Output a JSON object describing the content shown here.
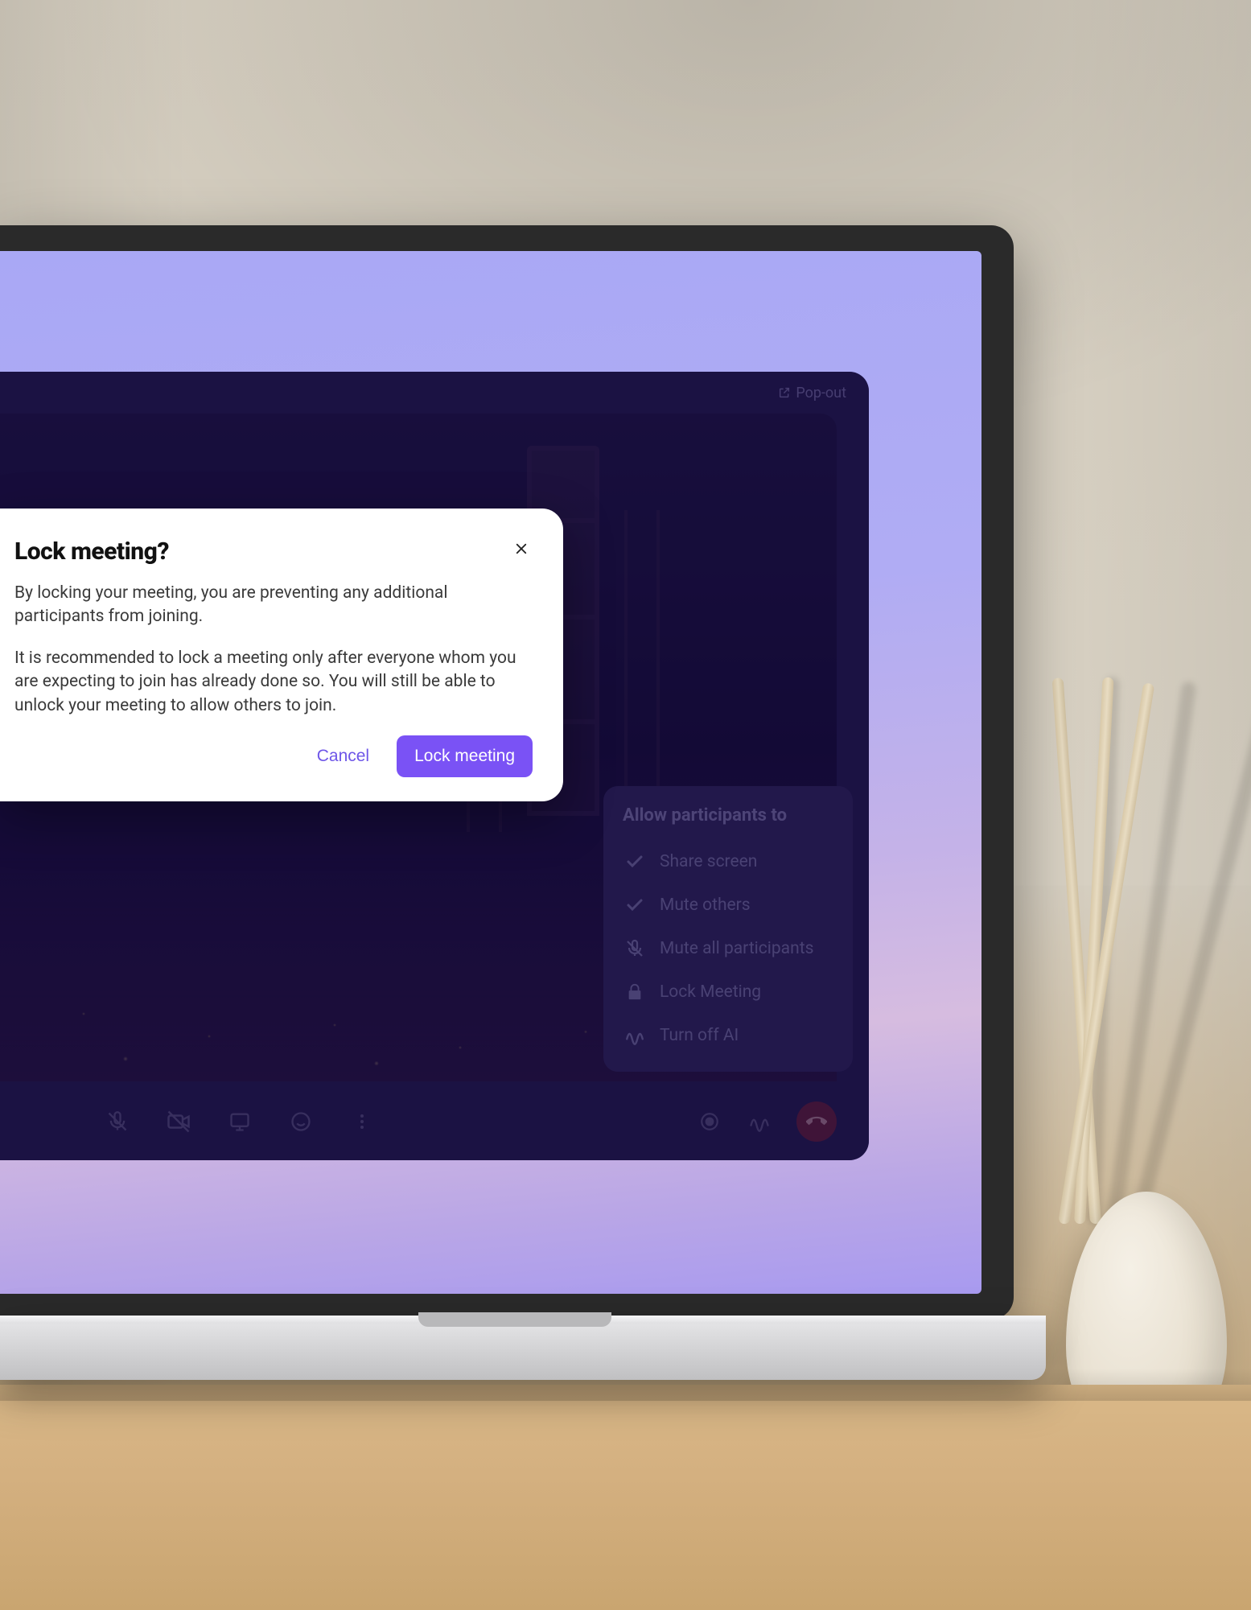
{
  "app": {
    "popout_label": "Pop-out"
  },
  "host_menu": {
    "title": "Allow participants to",
    "items": [
      {
        "icon": "check",
        "label": "Share screen"
      },
      {
        "icon": "check",
        "label": "Mute others"
      },
      {
        "icon": "mic-off",
        "label": "Mute all participants"
      },
      {
        "icon": "lock",
        "label": "Lock Meeting"
      },
      {
        "icon": "ai",
        "label": "Turn off AI"
      }
    ]
  },
  "toolbar": {
    "icons": [
      "mic-off",
      "video-off",
      "screen-share",
      "emoji",
      "more"
    ],
    "right_icons": [
      "record",
      "ai"
    ]
  },
  "modal": {
    "title": "Lock meeting?",
    "paragraph1": "By locking your meeting, you are preventing any additional participants from joining.",
    "paragraph2": "It is recommended to lock a meeting only after everyone whom you are expecting to join has already done so. You will still be able to unlock your meeting to allow others to join.",
    "cancel_label": "Cancel",
    "confirm_label": "Lock meeting"
  },
  "colors": {
    "primary": "#7a52f5",
    "app_bg": "#2a1f5e"
  }
}
